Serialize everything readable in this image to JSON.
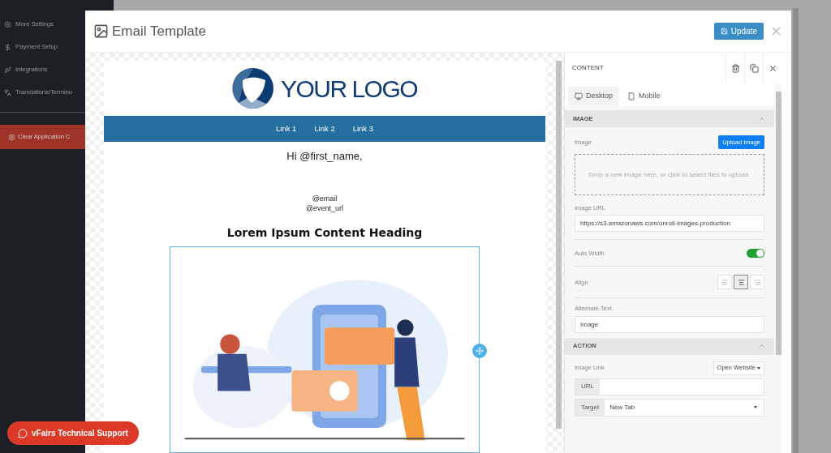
{
  "sidebar": {
    "items": [
      {
        "kind": "gear",
        "label": "More Settings"
      },
      {
        "kind": "dollar",
        "label": "Payment Setup"
      },
      {
        "kind": "usb",
        "label": "Integrations"
      },
      {
        "kind": "translate",
        "label": "Translations/Termino"
      }
    ],
    "action_button": "Clear Application C"
  },
  "modal": {
    "title": "Email Template",
    "update_button": "Update",
    "email": {
      "logo_text": "YOUR LOGO",
      "nav_links": [
        "Link 1",
        "Link 2",
        "Link 3"
      ],
      "greeting": "Hi @first_name,",
      "merge_fields": [
        "@email",
        "@event_url"
      ],
      "heading": "Lorem Ipsum Content Heading",
      "image": {
        "kind": "picture"
      }
    },
    "panel": {
      "title": "CONTENT",
      "tabs": [
        {
          "kind": "desktop",
          "label": "Desktop",
          "selected": true
        },
        {
          "kind": "mobile",
          "label": "Mobile",
          "selected": false
        }
      ],
      "image_section": {
        "title": "IMAGE",
        "image_label": "Image",
        "upload_button": "Upload Image",
        "dropzone": "Drop a new image here, or click to select files to upload.",
        "url_label": "Image URL",
        "url_value": "https://s3.amazonaws.com/unroll-images-production",
        "auto_width_label": "Auto Width",
        "auto_width_on": true,
        "align_label": "Align",
        "align_options": [
          {
            "kind": "left",
            "selected": false
          },
          {
            "kind": "center",
            "selected": true
          },
          {
            "kind": "right",
            "selected": false
          }
        ],
        "alt_label": "Alternate Text",
        "alt_value": "Image"
      },
      "action_section": {
        "title": "ACTION",
        "link_label": "Image Link",
        "link_type": "Open Website",
        "url_addon": "URL",
        "target_addon": "Target",
        "target_value": "New Tab"
      }
    }
  },
  "support_button": "vFairs Technical Support"
}
